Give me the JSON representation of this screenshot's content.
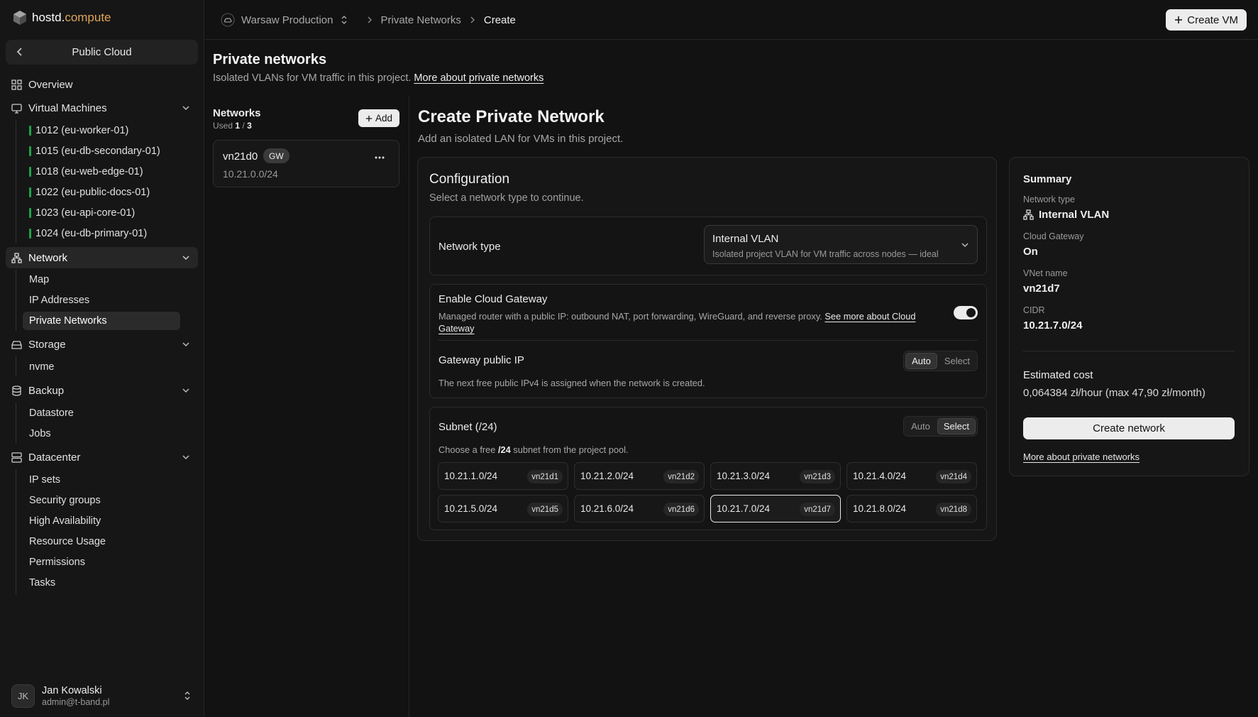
{
  "brand": {
    "name_main": "hostd.",
    "name_accent": "compute",
    "accent_color": "#e0a45a"
  },
  "sidebar": {
    "scope_label": "Public Cloud",
    "overview": "Overview",
    "vms": {
      "label": "Virtual Machines",
      "items": [
        "1012 (eu-worker-01)",
        "1015 (eu-db-secondary-01)",
        "1018 (eu-web-edge-01)",
        "1022 (eu-public-docs-01)",
        "1023 (eu-api-core-01)",
        "1024 (eu-db-primary-01)"
      ],
      "status_color": "#1fa34a"
    },
    "network": {
      "label": "Network",
      "items": [
        "Map",
        "IP Addresses",
        "Private Networks"
      ]
    },
    "storage": {
      "label": "Storage",
      "items": [
        "nvme"
      ]
    },
    "backup": {
      "label": "Backup",
      "items": [
        "Datastore",
        "Jobs"
      ]
    },
    "datacenter": {
      "label": "Datacenter",
      "items": [
        "IP sets",
        "Security groups",
        "High Availability",
        "Resource Usage",
        "Permissions",
        "Tasks"
      ]
    },
    "user": {
      "initials": "JK",
      "name": "Jan Kowalski",
      "email": "admin@t-band.pl"
    }
  },
  "topbar": {
    "project": "Warsaw Production",
    "crumbs": [
      "Private Networks",
      "Create"
    ],
    "create_vm": "Create VM"
  },
  "page": {
    "title": "Private networks",
    "subtitle": "Isolated VLANs for VM traffic in this project.",
    "subtitle_link": "More about private networks"
  },
  "networks": {
    "heading": "Networks",
    "used_label": "Used",
    "used": "1",
    "total": "3",
    "add_label": "Add",
    "items": [
      {
        "name": "vn21d0",
        "badge": "GW",
        "cidr": "10.21.0.0/24"
      }
    ]
  },
  "create": {
    "title": "Create Private Network",
    "subtitle": "Add an isolated LAN for VMs in this project.",
    "config": {
      "title": "Configuration",
      "subtitle": "Select a network type to continue.",
      "network_type_label": "Network type",
      "network_type_value": "Internal VLAN",
      "network_type_desc": "Isolated project VLAN for VM traffic across nodes — ideal",
      "gateway_label": "Enable Cloud Gateway",
      "gateway_desc": "Managed router with a public IP: outbound NAT, port forwarding, WireGuard, and reverse proxy.",
      "gateway_link": "See more about Cloud Gateway",
      "gateway_enabled": true,
      "public_ip_label": "Gateway public IP",
      "public_ip_mode": "Auto",
      "seg_auto": "Auto",
      "seg_select": "Select",
      "public_ip_desc": "The next free public IPv4 is assigned when the network is created.",
      "subnet_label": "Subnet (/24)",
      "subnet_mode": "Select",
      "subnet_desc_pre": "Choose a free ",
      "subnet_desc_bold": "/24",
      "subnet_desc_post": " subnet from the project pool.",
      "subnets": [
        {
          "cidr": "10.21.1.0/24",
          "tag": "vn21d1"
        },
        {
          "cidr": "10.21.2.0/24",
          "tag": "vn21d2"
        },
        {
          "cidr": "10.21.3.0/24",
          "tag": "vn21d3"
        },
        {
          "cidr": "10.21.4.0/24",
          "tag": "vn21d4"
        },
        {
          "cidr": "10.21.5.0/24",
          "tag": "vn21d5"
        },
        {
          "cidr": "10.21.6.0/24",
          "tag": "vn21d6"
        },
        {
          "cidr": "10.21.7.0/24",
          "tag": "vn21d7"
        },
        {
          "cidr": "10.21.8.0/24",
          "tag": "vn21d8"
        }
      ],
      "selected_subnet": "10.21.7.0/24"
    }
  },
  "summary": {
    "title": "Summary",
    "network_type_k": "Network type",
    "network_type_v": "Internal VLAN",
    "gateway_k": "Cloud Gateway",
    "gateway_v": "On",
    "vnet_k": "VNet name",
    "vnet_v": "vn21d7",
    "cidr_k": "CIDR",
    "cidr_v": "10.21.7.0/24",
    "cost_label": "Estimated cost",
    "cost_value": "0,064384 zł/hour (max 47,90 zł/month)",
    "create_button": "Create network",
    "link": "More about private networks"
  }
}
